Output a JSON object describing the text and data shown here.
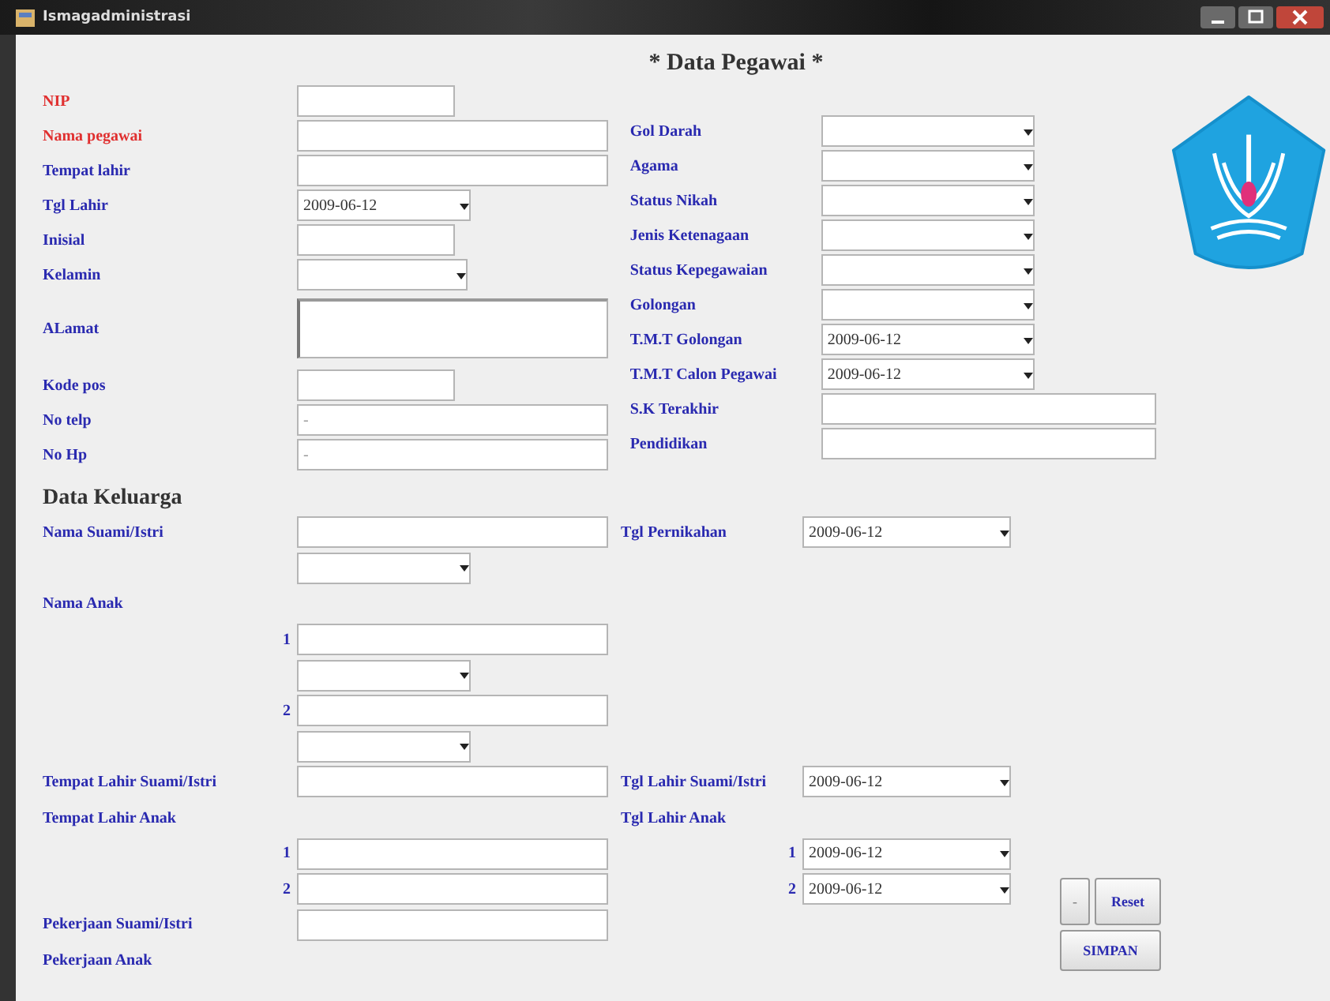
{
  "window": {
    "title": "Ismagadministrasi"
  },
  "form_title": "* Data Pegawai *",
  "left_fields": [
    {
      "label": "NIP",
      "required": true,
      "kind": "short-text"
    },
    {
      "label": "Nama pegawai",
      "required": true,
      "kind": "text"
    },
    {
      "label": "Tempat lahir",
      "required": false,
      "kind": "text"
    },
    {
      "label": "Tgl Lahir",
      "required": false,
      "kind": "date",
      "value": "2009-06-12"
    },
    {
      "label": "Inisial",
      "required": false,
      "kind": "short-text"
    },
    {
      "label": "Kelamin",
      "required": false,
      "kind": "combo"
    },
    {
      "label": "ALamat",
      "required": false,
      "kind": "textarea"
    },
    {
      "label": "Kode pos",
      "required": false,
      "kind": "short-text"
    },
    {
      "label": "No telp",
      "required": false,
      "kind": "text",
      "placeholder": "-"
    },
    {
      "label": "No Hp",
      "required": false,
      "kind": "text",
      "placeholder": "-"
    }
  ],
  "right_fields": [
    {
      "label": "Gol Darah",
      "kind": "combo"
    },
    {
      "label": "Agama",
      "kind": "combo"
    },
    {
      "label": "Status Nikah",
      "kind": "combo"
    },
    {
      "label": "Jenis Ketenagaan",
      "kind": "combo"
    },
    {
      "label": "Status Kepegawaian",
      "kind": "combo"
    },
    {
      "label": "Golongan",
      "kind": "combo"
    },
    {
      "label": "T.M.T Golongan",
      "kind": "date",
      "value": "2009-06-12"
    },
    {
      "label": "T.M.T Calon Pegawai",
      "kind": "date",
      "value": "2009-06-12"
    },
    {
      "label": "S.K Terakhir",
      "kind": "text"
    },
    {
      "label": "Pendidikan",
      "kind": "text"
    }
  ],
  "family": {
    "heading": "Data Keluarga",
    "rows": [
      {
        "left": {
          "label": "Nama Suami/Istri",
          "field": {
            "kind": "text"
          }
        },
        "right": {
          "label": "Tgl Pernikahan",
          "field": {
            "kind": "date",
            "value": "2009-06-12"
          }
        }
      },
      {
        "left": {
          "field": {
            "kind": "combo"
          }
        }
      },
      {
        "left": {
          "label": "Nama Anak"
        }
      },
      {
        "left": {
          "number": "1",
          "field": {
            "kind": "text"
          }
        }
      },
      {
        "left": {
          "field": {
            "kind": "combo"
          }
        }
      },
      {
        "left": {
          "number": "2",
          "field": {
            "kind": "text"
          }
        }
      },
      {
        "left": {
          "field": {
            "kind": "combo"
          }
        }
      },
      {
        "left": {
          "label": "Tempat Lahir Suami/Istri",
          "field": {
            "kind": "text"
          }
        },
        "right": {
          "label": "Tgl Lahir Suami/Istri",
          "field": {
            "kind": "date",
            "value": "2009-06-12"
          }
        }
      },
      {
        "left": {
          "label": "Tempat Lahir Anak"
        },
        "right": {
          "label": "Tgl Lahir Anak"
        }
      },
      {
        "left": {
          "number": "1",
          "field": {
            "kind": "text"
          }
        },
        "right": {
          "number": "1",
          "field": {
            "kind": "date",
            "value": "2009-06-12"
          }
        }
      },
      {
        "left": {
          "number": "2",
          "field": {
            "kind": "text"
          }
        },
        "right": {
          "number": "2",
          "field": {
            "kind": "date",
            "value": "2009-06-12"
          }
        }
      },
      {
        "left": {
          "label": "Pekerjaan Suami/Istri",
          "field": {
            "kind": "text"
          }
        }
      },
      {
        "left": {
          "label": "Pekerjaan Anak"
        }
      }
    ]
  },
  "buttons": [
    {
      "label": "-"
    },
    {
      "label": "Reset"
    },
    {
      "label": "SIMPAN"
    }
  ]
}
